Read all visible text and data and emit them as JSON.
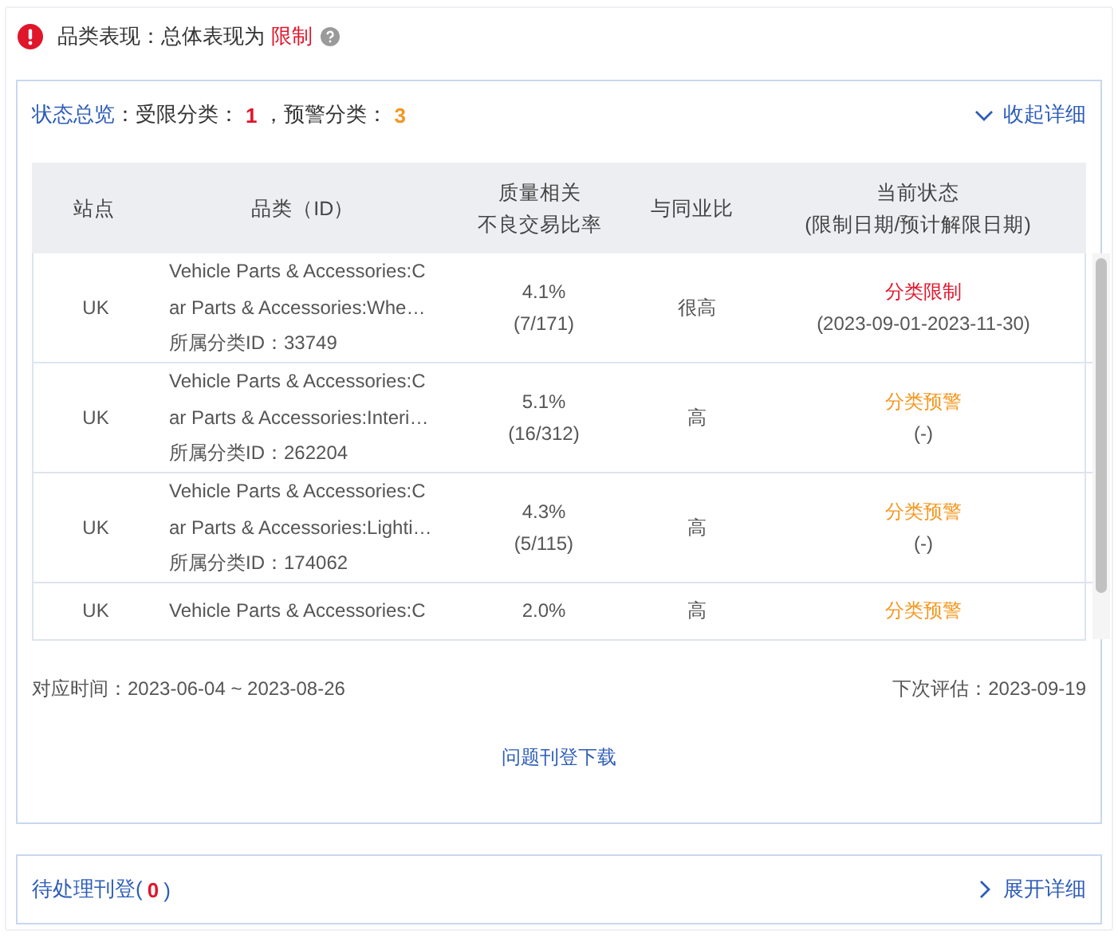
{
  "header": {
    "label": "品类表现：总体表现为",
    "status": "限制"
  },
  "overview": {
    "title": "状态总览",
    "restricted_label": "：受限分类：",
    "restricted_count": "1",
    "warning_label": "，预警分类：",
    "warning_count": "3",
    "toggle": "收起详细",
    "expanded": true
  },
  "table": {
    "columns": [
      {
        "lines": [
          "站点"
        ]
      },
      {
        "lines": [
          "品类（ID）"
        ]
      },
      {
        "lines": [
          "质量相关",
          "不良交易比率"
        ]
      },
      {
        "lines": [
          "与同业比"
        ]
      },
      {
        "lines": [
          "当前状态",
          "(限制日期/预计解限日期)"
        ]
      }
    ],
    "rows": [
      {
        "site": "UK",
        "name_lines": [
          "Vehicle Parts & Accessories:C",
          "ar Parts & Accessories:Whe…"
        ],
        "category_id": "所属分类ID：33749",
        "rate": "4.1%",
        "ratio": "(7/171)",
        "comparison": "很高",
        "status": {
          "kind": "restricted",
          "label": "分类限制",
          "dates": "(2023-09-01-2023-11-30)"
        }
      },
      {
        "site": "UK",
        "name_lines": [
          "Vehicle Parts & Accessories:C",
          "ar Parts & Accessories:Interi…"
        ],
        "category_id": "所属分类ID：262204",
        "rate": "5.1%",
        "ratio": "(16/312)",
        "comparison": "高",
        "status": {
          "kind": "warning",
          "label": "分类预警",
          "dates": "(-)"
        }
      },
      {
        "site": "UK",
        "name_lines": [
          "Vehicle Parts & Accessories:C",
          "ar Parts & Accessories:Lighti…"
        ],
        "category_id": "所属分类ID：174062",
        "rate": "4.3%",
        "ratio": "(5/115)",
        "comparison": "高",
        "status": {
          "kind": "warning",
          "label": "分类预警",
          "dates": "(-)"
        }
      },
      {
        "site": "UK",
        "name_lines": [
          "Vehicle Parts & Accessories:C"
        ],
        "rate": "2.0%",
        "comparison": "高",
        "status": {
          "kind": "warning",
          "label": "分类预警"
        }
      }
    ]
  },
  "footer": {
    "period": "对应时间：2023-06-04 ~ 2023-08-26",
    "next_review": "下次评估：2023-09-19",
    "download": "问题刊登下载"
  },
  "pending": {
    "label": "待处理刊登(",
    "count": "0",
    "close": ")",
    "toggle": "展开详细",
    "expanded": false
  }
}
